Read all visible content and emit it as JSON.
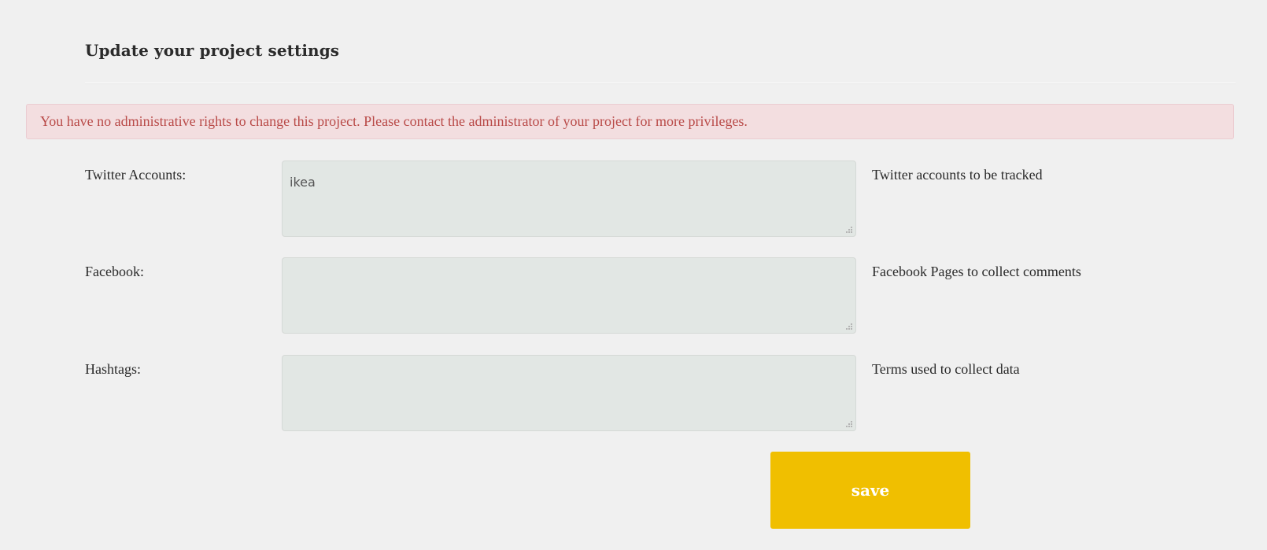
{
  "page": {
    "title": "Update your project settings"
  },
  "alert": {
    "message": "You have no administrative rights to change this project. Please contact the administrator of your project for more privileges.",
    "color": "#b94a48",
    "background": "#f3dee0"
  },
  "fields": [
    {
      "label": "Twitter Accounts:",
      "value": "ikea",
      "help": "Twitter accounts to be tracked"
    },
    {
      "label": "Facebook:",
      "value": "",
      "help": "Facebook Pages to collect comments"
    },
    {
      "label": "Hashtags:",
      "value": "",
      "help": "Terms used to collect data"
    }
  ],
  "actions": {
    "save_label": "save",
    "save_color": "#f0bf00"
  },
  "icons": {
    "resize": "resize-handle-icon"
  }
}
